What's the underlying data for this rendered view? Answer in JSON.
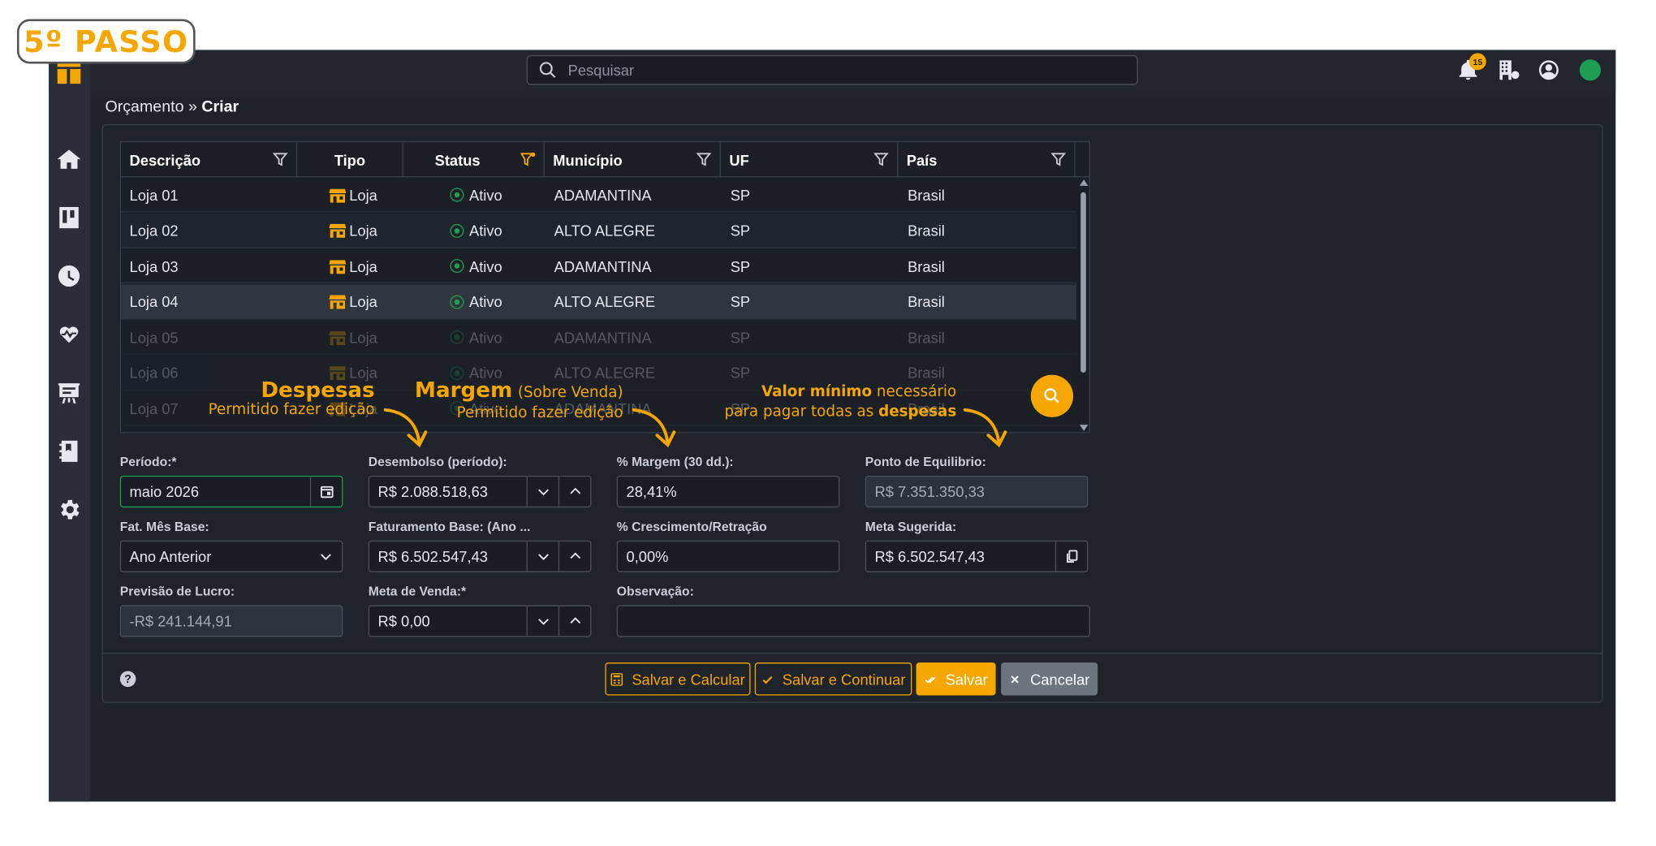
{
  "step_label": "5º PASSO",
  "search": {
    "placeholder": "Pesquisar"
  },
  "notifications": {
    "count": "15"
  },
  "breadcrumb": {
    "parent": "Orçamento",
    "separator": "»",
    "current": "Criar"
  },
  "sidebar": {
    "items": [
      "home-icon",
      "board-icon",
      "clock-icon",
      "heart-pulse-icon",
      "presentation-icon",
      "notebook-icon",
      "gear-icon"
    ]
  },
  "table": {
    "columns": [
      "Descrição",
      "Tipo",
      "Status",
      "Município",
      "UF",
      "País"
    ],
    "rows": [
      {
        "descricao": "Loja 01",
        "tipo": "Loja",
        "status": "Ativo",
        "municipio": "ADAMANTINA",
        "uf": "SP",
        "pais": "Brasil"
      },
      {
        "descricao": "Loja 02",
        "tipo": "Loja",
        "status": "Ativo",
        "municipio": "ALTO ALEGRE",
        "uf": "SP",
        "pais": "Brasil"
      },
      {
        "descricao": "Loja 03",
        "tipo": "Loja",
        "status": "Ativo",
        "municipio": "ADAMANTINA",
        "uf": "SP",
        "pais": "Brasil"
      },
      {
        "descricao": "Loja 04",
        "tipo": "Loja",
        "status": "Ativo",
        "municipio": "ALTO ALEGRE",
        "uf": "SP",
        "pais": "Brasil"
      },
      {
        "descricao": "Loja 05",
        "tipo": "Loja",
        "status": "Ativo",
        "municipio": "ADAMANTINA",
        "uf": "SP",
        "pais": "Brasil"
      },
      {
        "descricao": "Loja 06",
        "tipo": "Loja",
        "status": "Ativo",
        "municipio": "ALTO ALEGRE",
        "uf": "SP",
        "pais": "Brasil"
      },
      {
        "descricao": "Loja 07",
        "tipo": "Loja",
        "status": "Ativo",
        "municipio": "ADAMANTINA",
        "uf": "SP",
        "pais": "Brasil"
      }
    ]
  },
  "annotations": {
    "despesas": {
      "title": "Despesas",
      "subtitle": "Permitido fazer edição"
    },
    "margem": {
      "title": "Margem",
      "title_suffix": "(Sobre Venda)",
      "subtitle": "Permitido fazer edição"
    },
    "valor_minimo": {
      "bold1": "Valor mínimo",
      "text1": "necessário",
      "text2": "para pagar todas as",
      "bold2": "despesas"
    }
  },
  "form": {
    "periodo": {
      "label": "Período:*",
      "value": "maio 2026"
    },
    "desembolso": {
      "label": "Desembolso (período):",
      "value": "R$ 2.088.518,63"
    },
    "margem": {
      "label": "% Margem (30 dd.):",
      "value": "28,41%"
    },
    "ponto_equilibrio": {
      "label": "Ponto de Equilibrio:",
      "value": "R$ 7.351.350,33"
    },
    "fat_mes_base": {
      "label": "Fat. Mês Base:",
      "value": "Ano Anterior"
    },
    "faturamento_base": {
      "label": "Faturamento Base: (Ano ...",
      "value": "R$ 6.502.547,43"
    },
    "crescimento": {
      "label": "% Crescimento/Retração",
      "value": "0,00%"
    },
    "meta_sugerida": {
      "label": "Meta Sugerida:",
      "value": "R$ 6.502.547,43"
    },
    "previsao_lucro": {
      "label": "Previsão de Lucro:",
      "value": "-R$ 241.144,91"
    },
    "meta_venda": {
      "label": "Meta de Venda:*",
      "value": "R$ 0,00"
    },
    "observacao": {
      "label": "Observação:",
      "value": ""
    }
  },
  "buttons": {
    "salvar_calcular": "Salvar e Calcular",
    "salvar_continuar": "Salvar e Continuar",
    "salvar": "Salvar",
    "cancelar": "Cancelar",
    "help": "?"
  },
  "colors": {
    "accent": "#f5a600",
    "active": "#1e9e55",
    "background": "#1e232a"
  }
}
